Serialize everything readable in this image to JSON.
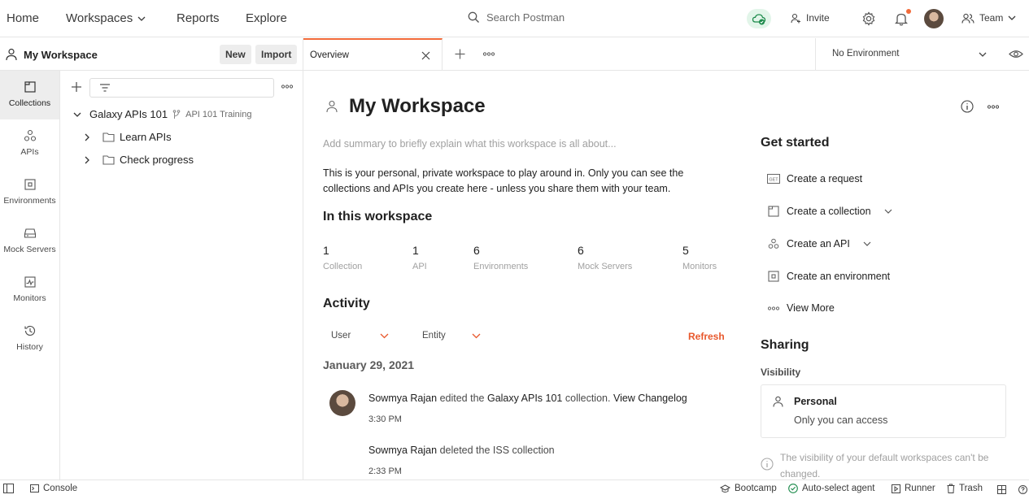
{
  "nav": {
    "home": "Home",
    "workspaces": "Workspaces",
    "reports": "Reports",
    "explore": "Explore",
    "search_placeholder": "Search Postman",
    "invite": "Invite",
    "team": "Team"
  },
  "workspace_header": {
    "title": "My Workspace",
    "new_label": "New",
    "import_label": "Import"
  },
  "rail": [
    {
      "label": "Collections",
      "icon": "collections-icon"
    },
    {
      "label": "APIs",
      "icon": "apis-icon"
    },
    {
      "label": "Environments",
      "icon": "environments-icon"
    },
    {
      "label": "Mock Servers",
      "icon": "mock-servers-icon"
    },
    {
      "label": "Monitors",
      "icon": "monitors-icon"
    },
    {
      "label": "History",
      "icon": "history-icon"
    }
  ],
  "collections": {
    "root": {
      "name": "Galaxy APIs 101",
      "fork_label": "API 101 Training"
    },
    "folders": [
      "Learn APIs",
      "Check progress"
    ]
  },
  "tabs": {
    "active_tab": "Overview",
    "environment": "No Environment"
  },
  "overview": {
    "title": "My Workspace",
    "summary_placeholder": "Add summary to briefly explain what this workspace is all about...",
    "description": "This is your personal, private workspace to play around in. Only you can see the collections and APIs you create here - unless you share them with your team.",
    "in_workspace_heading": "In this workspace",
    "stats": [
      {
        "count": "1",
        "label": "Collection"
      },
      {
        "count": "1",
        "label": "API"
      },
      {
        "count": "6",
        "label": "Environments"
      },
      {
        "count": "6",
        "label": "Mock Servers"
      },
      {
        "count": "5",
        "label": "Monitors"
      }
    ],
    "activity_heading": "Activity",
    "filter_user": "User",
    "filter_entity": "Entity",
    "refresh": "Refresh",
    "date": "January 29, 2021",
    "activities": [
      {
        "user": "Sowmya Rajan",
        "action_before": "edited the",
        "entity": "Galaxy APIs 101",
        "action_after": "collection.",
        "link": "View Changelog",
        "time": "3:30 PM"
      },
      {
        "user": "Sowmya Rajan",
        "action_before": "deleted the ISS collection",
        "entity": "",
        "action_after": "",
        "link": "",
        "time": "2:33 PM"
      }
    ]
  },
  "get_started": {
    "heading": "Get started",
    "items": [
      "Create a request",
      "Create a collection",
      "Create an API",
      "Create an environment",
      "View More"
    ]
  },
  "sharing": {
    "heading": "Sharing",
    "visibility_label": "Visibility",
    "card_title": "Personal",
    "card_desc": "Only you can access",
    "note": "The visibility of your default workspaces can't be changed."
  },
  "statusbar": {
    "console": "Console",
    "bootcamp": "Bootcamp",
    "auto_select": "Auto-select agent",
    "runner": "Runner",
    "trash": "Trash"
  },
  "colors": {
    "accent": "#f26b3a",
    "refresh": "#e8582c",
    "sync_bg": "#e2f5e9",
    "sync_icon": "#1b8a4a"
  }
}
